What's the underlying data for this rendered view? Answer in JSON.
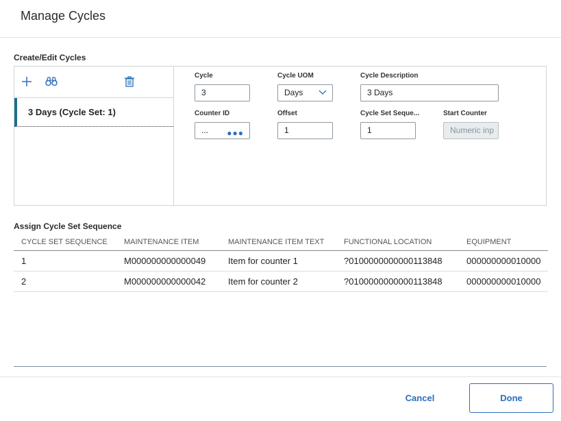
{
  "dialog": {
    "title": "Manage Cycles"
  },
  "create_edit": {
    "section_title": "Create/Edit Cycles",
    "toolbar": {
      "add_icon": "plus-icon",
      "search_icon": "binoculars-icon",
      "delete_icon": "trash-icon"
    },
    "list": [
      {
        "label": "3 Days (Cycle Set: 1)",
        "selected": true
      }
    ],
    "fields": {
      "cycle": {
        "label": "Cycle",
        "value": "3"
      },
      "cycle_uom": {
        "label": "Cycle UOM",
        "value": "Days"
      },
      "cycle_description": {
        "label": "Cycle Description",
        "value": "3 Days"
      },
      "counter_id": {
        "label": "Counter ID",
        "value": "..."
      },
      "offset": {
        "label": "Offset",
        "value": "1"
      },
      "cycle_set_sequence": {
        "label": "Cycle Set Seque...",
        "value": "1"
      },
      "start_counter": {
        "label": "Start Counter",
        "placeholder": "Numeric inp"
      }
    }
  },
  "assign": {
    "section_title": "Assign Cycle Set Sequence",
    "columns": [
      "CYCLE SET SEQUENCE",
      "MAINTENANCE ITEM",
      "MAINTENANCE ITEM TEXT",
      "FUNCTIONAL LOCATION",
      "EQUIPMENT"
    ],
    "rows": [
      [
        "1",
        "M000000000000049",
        "Item for counter 1",
        "?0100000000000113848",
        "000000000010000"
      ],
      [
        "2",
        "M000000000000042",
        "Item for counter 2",
        "?0100000000000113848",
        "000000000010000"
      ]
    ]
  },
  "footer": {
    "cancel_label": "Cancel",
    "done_label": "Done"
  },
  "colors": {
    "accent": "#1c6f8a",
    "link_blue": "#2a6ebd"
  }
}
